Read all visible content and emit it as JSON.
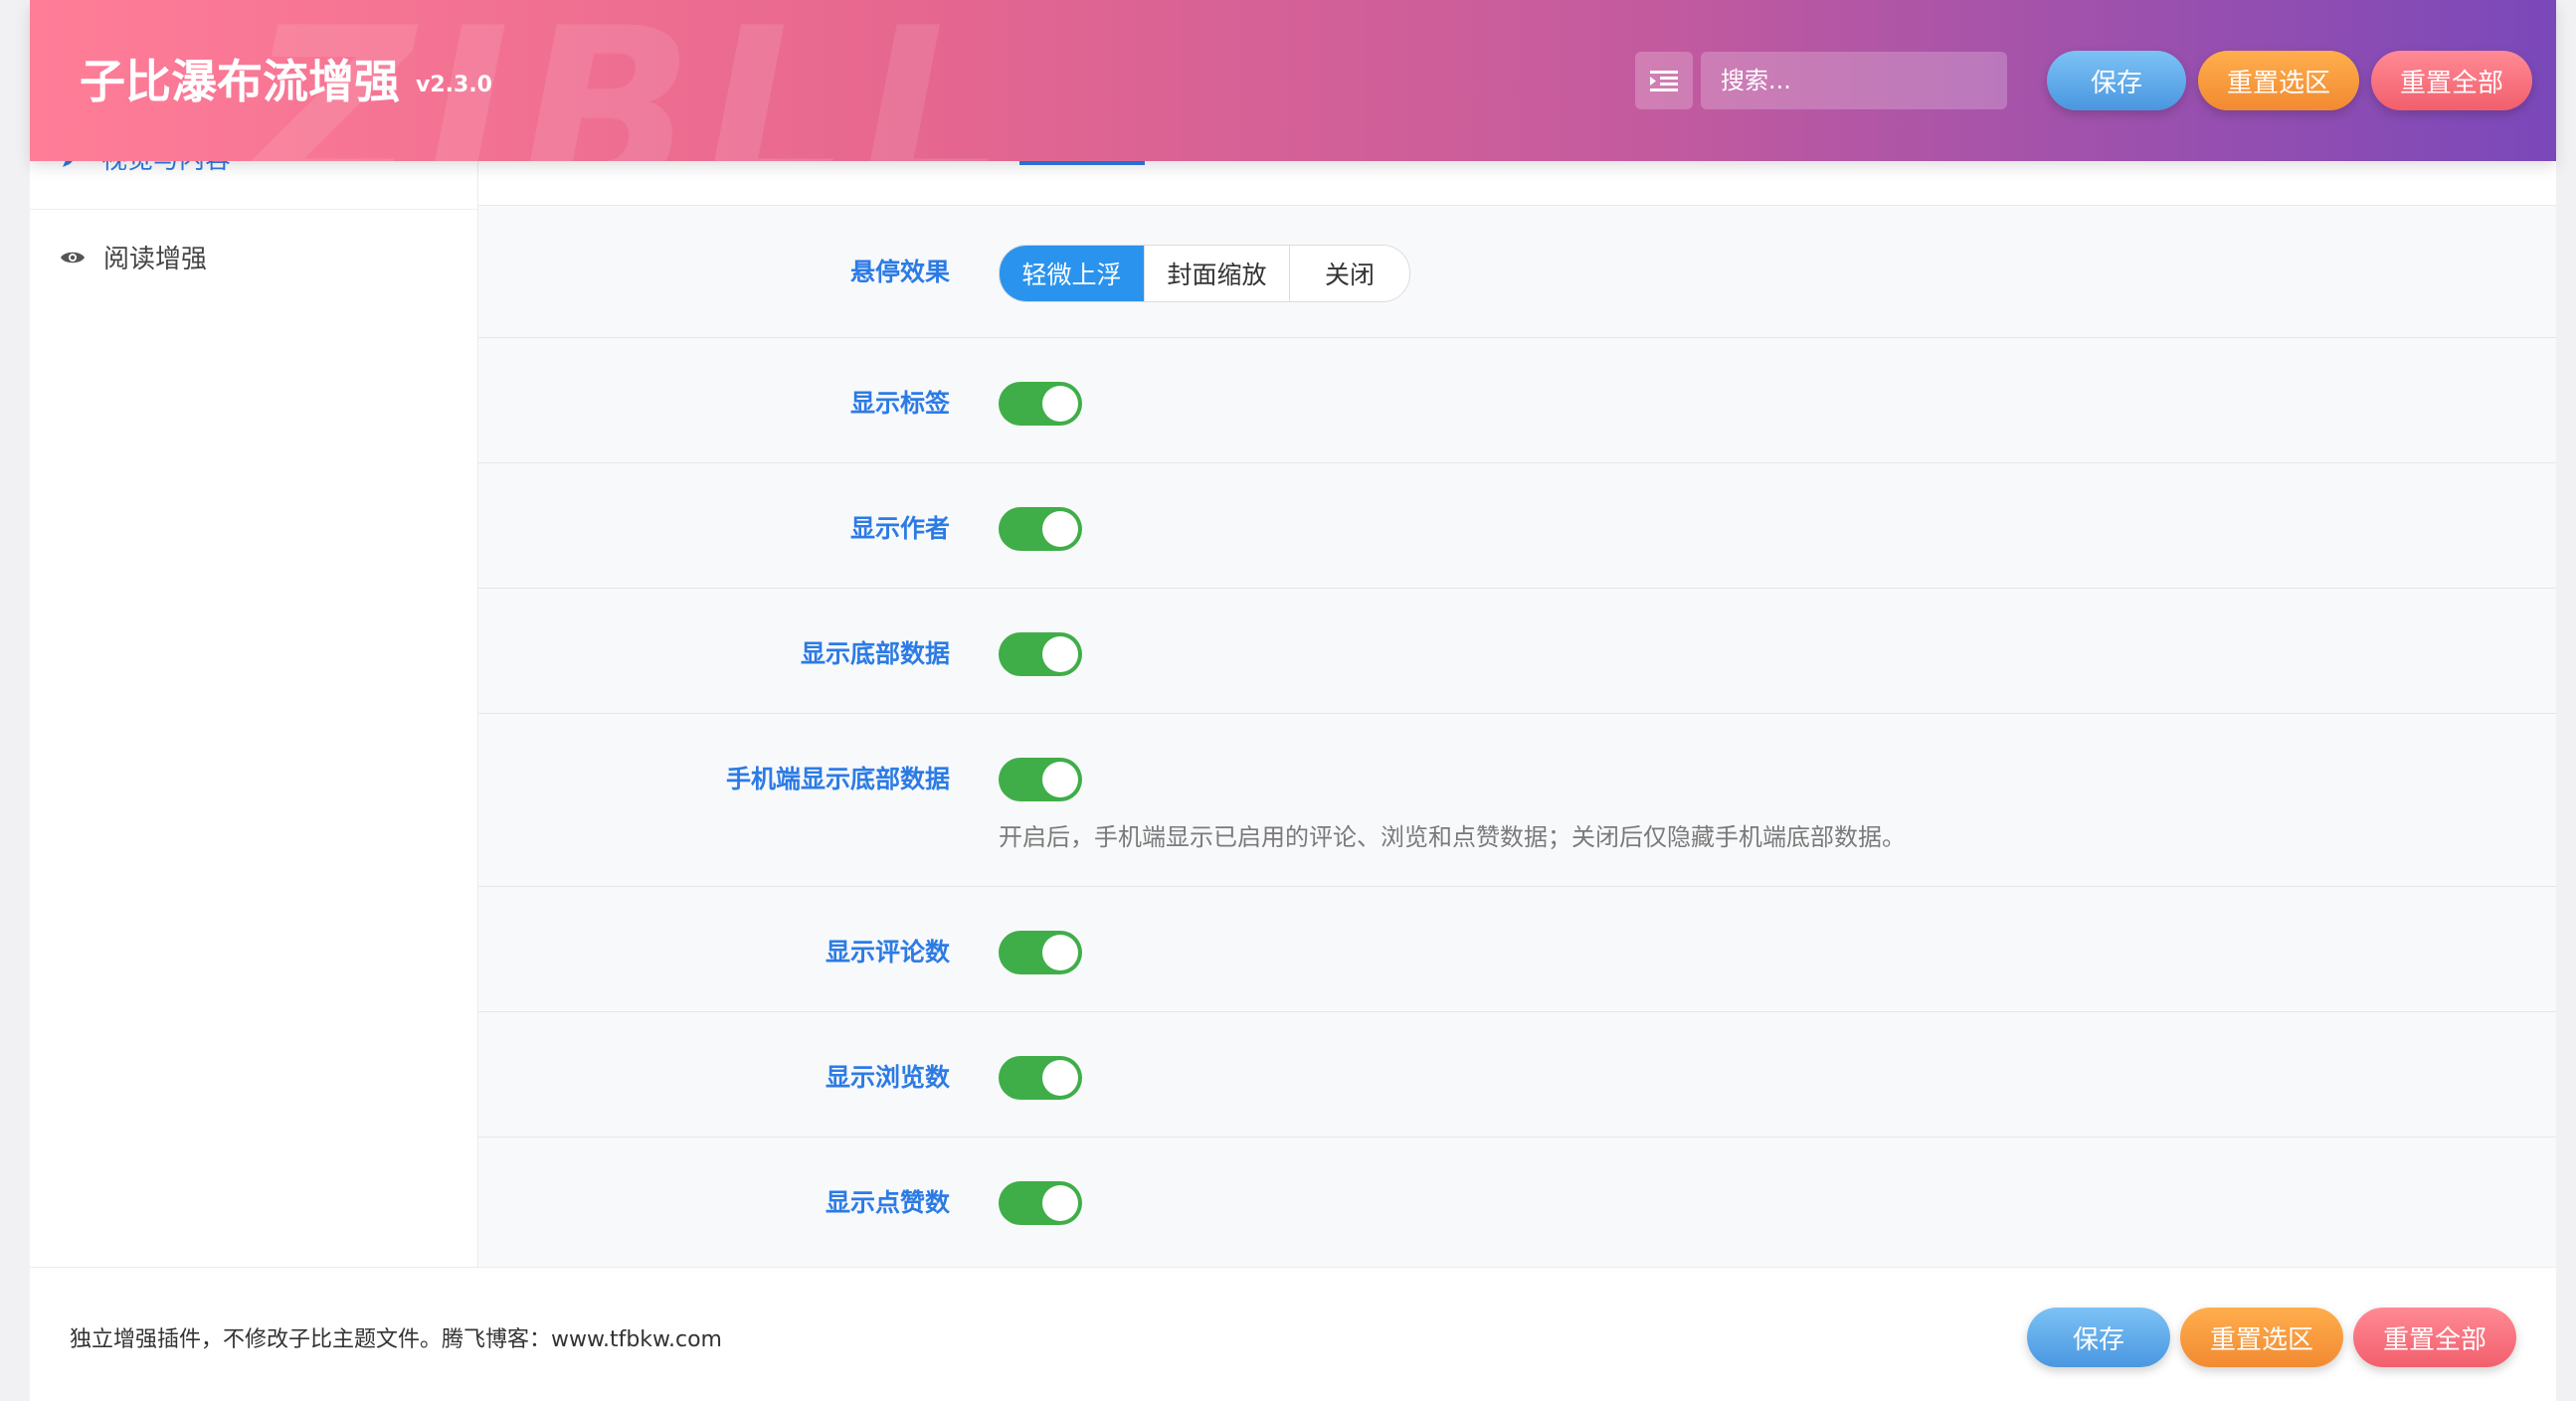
{
  "header": {
    "watermark": "ZIBLL",
    "title": "子比瀑布流增强",
    "version": "v2.3.0",
    "menu_icon": "list-indent-icon",
    "search_placeholder": "搜索...",
    "save_label": "保存",
    "reset_section_label": "重置选区",
    "reset_all_label": "重置全部"
  },
  "sidebar": {
    "items": [
      {
        "label": "视觉与内容",
        "icon": "pencil-icon",
        "active": true
      },
      {
        "label": "阅读增强",
        "icon": "eye-icon",
        "active": false
      }
    ]
  },
  "settings": {
    "hover": {
      "label": "悬停效果",
      "options": [
        "轻微上浮",
        "封面缩放",
        "关闭"
      ],
      "selected": "轻微上浮"
    },
    "show_tags": {
      "label": "显示标签",
      "on": true
    },
    "show_author": {
      "label": "显示作者",
      "on": true
    },
    "show_bottom_data": {
      "label": "显示底部数据",
      "on": true
    },
    "mobile_bottom_data": {
      "label": "手机端显示底部数据",
      "on": true,
      "description": "开启后，手机端显示已启用的评论、浏览和点赞数据；关闭后仅隐藏手机端底部数据。"
    },
    "show_comments": {
      "label": "显示评论数",
      "on": true
    },
    "show_views": {
      "label": "显示浏览数",
      "on": true
    },
    "show_likes": {
      "label": "显示点赞数",
      "on": true
    }
  },
  "footer": {
    "text": "独立增强插件，不修改子比主题文件。腾飞博客：www.tfbkw.com",
    "save_label": "保存",
    "reset_section_label": "重置选区",
    "reset_all_label": "重置全部"
  },
  "colors": {
    "accent_blue": "#2c7be5",
    "toggle_green": "#3fae48",
    "segment_active": "#2a93ee"
  }
}
